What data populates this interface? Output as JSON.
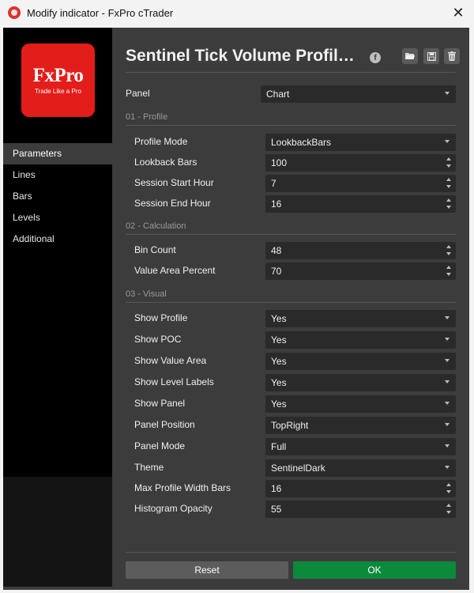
{
  "window": {
    "title": "Modify indicator - FxPro cTrader",
    "close_label": "✕"
  },
  "logo": {
    "main": "FxPro",
    "tagline": "Trade Like a Pro"
  },
  "sidebar": {
    "items": [
      {
        "label": "Parameters",
        "active": true
      },
      {
        "label": "Lines",
        "active": false
      },
      {
        "label": "Bars",
        "active": false
      },
      {
        "label": "Levels",
        "active": false
      },
      {
        "label": "Additional",
        "active": false
      }
    ]
  },
  "header": {
    "title": "Sentinel Tick Volume Profil…",
    "icons": [
      "facebook-icon",
      "folder-open-icon",
      "save-icon",
      "trash-icon"
    ]
  },
  "panel": {
    "label": "Panel",
    "value": "Chart"
  },
  "sections": {
    "profile": "01 - Profile",
    "calculation": "02 - Calculation",
    "visual": "03 - Visual"
  },
  "params": {
    "profile_mode": {
      "label": "Profile Mode",
      "value": "LookbackBars"
    },
    "lookback_bars": {
      "label": "Lookback Bars",
      "value": "100"
    },
    "session_start_hour": {
      "label": "Session Start Hour",
      "value": "7"
    },
    "session_end_hour": {
      "label": "Session End Hour",
      "value": "16"
    },
    "bin_count": {
      "label": "Bin Count",
      "value": "48"
    },
    "value_area_percent": {
      "label": "Value Area Percent",
      "value": "70"
    },
    "show_profile": {
      "label": "Show Profile",
      "value": "Yes"
    },
    "show_poc": {
      "label": "Show POC",
      "value": "Yes"
    },
    "show_value_area": {
      "label": "Show Value Area",
      "value": "Yes"
    },
    "show_level_labels": {
      "label": "Show Level Labels",
      "value": "Yes"
    },
    "show_panel": {
      "label": "Show Panel",
      "value": "Yes"
    },
    "panel_position": {
      "label": "Panel Position",
      "value": "TopRight"
    },
    "panel_mode": {
      "label": "Panel Mode",
      "value": "Full"
    },
    "theme": {
      "label": "Theme",
      "value": "SentinelDark"
    },
    "max_profile_width_bars": {
      "label": "Max Profile Width Bars",
      "value": "16"
    },
    "histogram_opacity": {
      "label": "Histogram Opacity",
      "value": "55"
    }
  },
  "buttons": {
    "reset": "Reset",
    "ok": "OK"
  },
  "colors": {
    "brand_red": "#e31d1a",
    "ok_green": "#0b8a3c",
    "dialog_bg": "#3c3c3c",
    "field_bg": "#2a2a2a"
  }
}
